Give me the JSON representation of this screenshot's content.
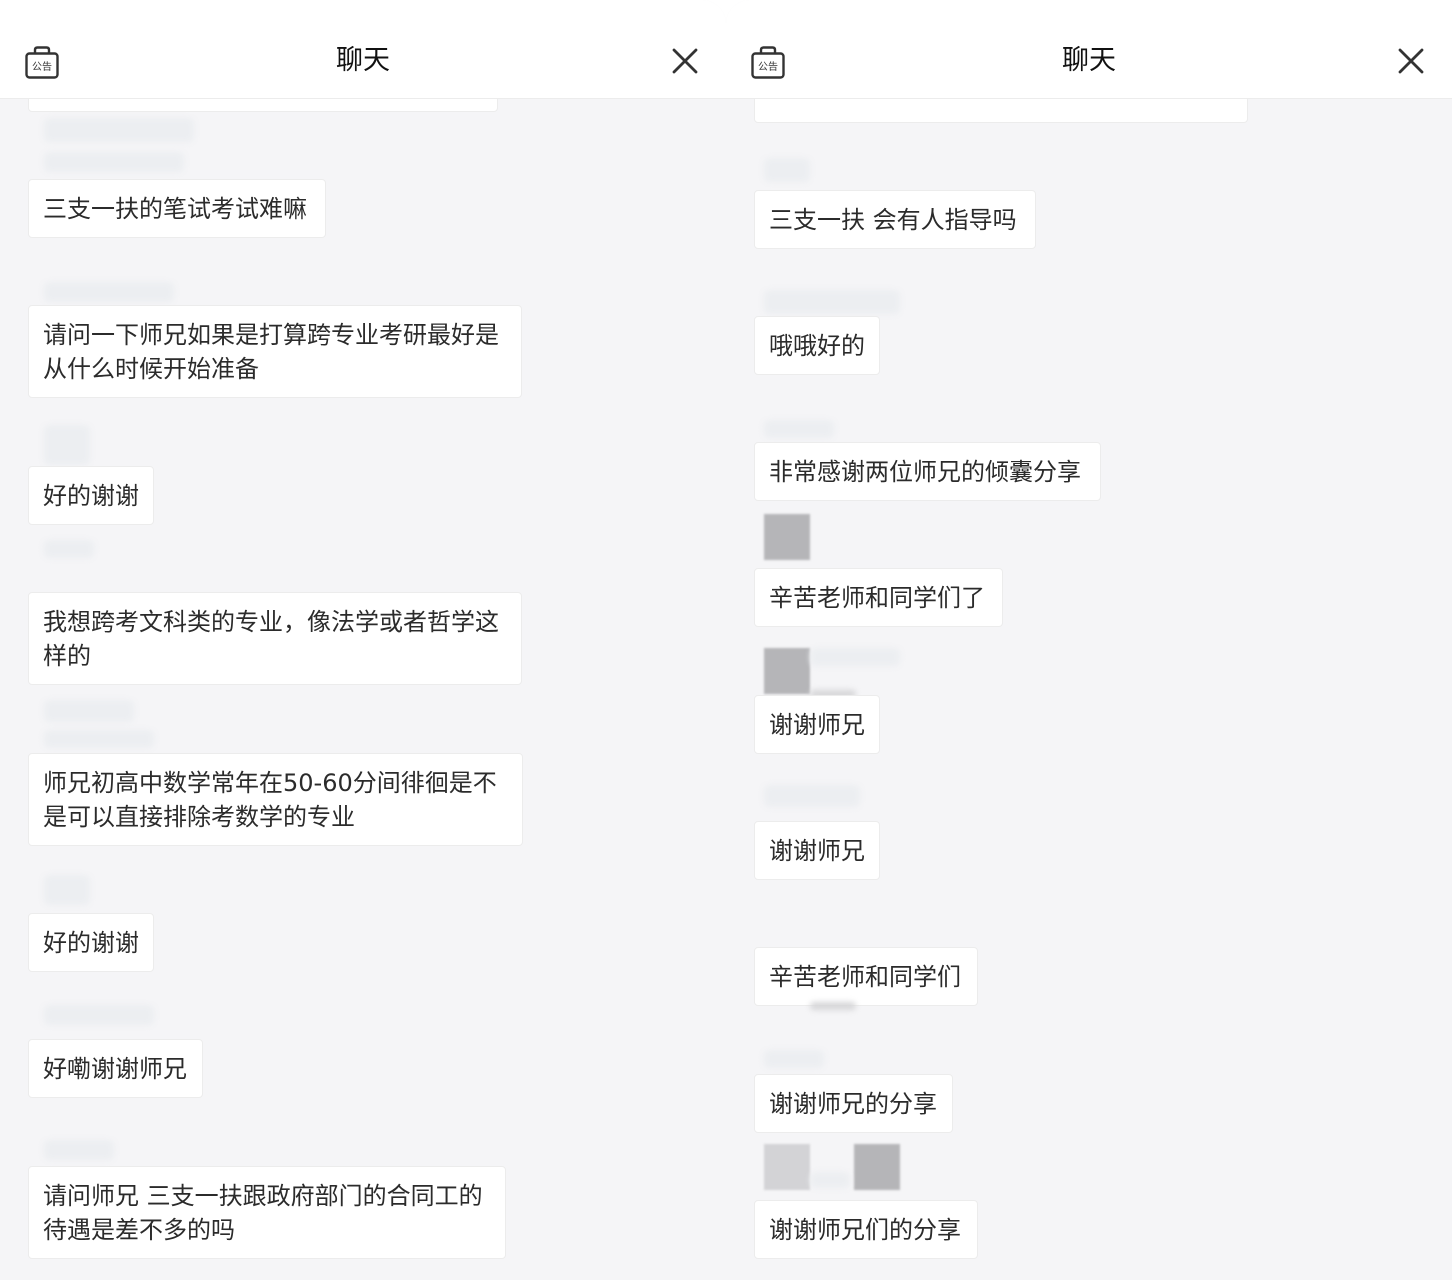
{
  "left_panel": {
    "title": "聊天",
    "notice_icon_label": "公告",
    "messages": [
      "三支一扶的笔试考试难嘛",
      "请问一下师兄如果是打算跨专业考研最好是从什么时候开始准备",
      "好的谢谢",
      "我想跨考文科类的专业，像法学或者哲学这样的",
      "师兄初高中数学常年在50-60分间徘徊是不是可以直接排除考数学的专业",
      "好的谢谢",
      "好嘞谢谢师兄",
      "请问师兄 三支一扶跟政府部门的合同工的待遇是差不多的吗"
    ]
  },
  "right_panel": {
    "title": "聊天",
    "notice_icon_label": "公告",
    "messages": [
      "三支一扶 会有人指导吗",
      "哦哦好的",
      "非常感谢两位师兄的倾囊分享",
      "辛苦老师和同学们了",
      "谢谢师兄",
      "谢谢师兄",
      "辛苦老师和同学们",
      "谢谢师兄的分享",
      "谢谢师兄们的分享"
    ]
  },
  "colors": {
    "chat_background": "#f5f5f7",
    "bubble_background": "#ffffff",
    "text": "#2b2b2b"
  }
}
